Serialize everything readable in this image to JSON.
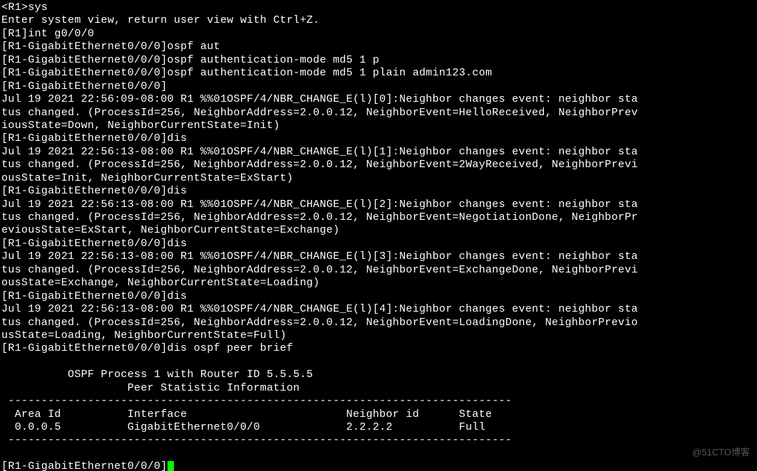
{
  "watermark": "@51CTO博客",
  "terminal": {
    "lines": [
      "<R1>sys",
      "Enter system view, return user view with Ctrl+Z.",
      "[R1]int g0/0/0",
      "[R1-GigabitEthernet0/0/0]ospf aut",
      "[R1-GigabitEthernet0/0/0]ospf authentication-mode md5 1 p",
      "[R1-GigabitEthernet0/0/0]ospf authentication-mode md5 1 plain admin123.com",
      "[R1-GigabitEthernet0/0/0]",
      "Jul 19 2021 22:56:09-08:00 R1 %%01OSPF/4/NBR_CHANGE_E(l)[0]:Neighbor changes event: neighbor sta",
      "tus changed. (ProcessId=256, NeighborAddress=2.0.0.12, NeighborEvent=HelloReceived, NeighborPrev",
      "iousState=Down, NeighborCurrentState=Init)",
      "[R1-GigabitEthernet0/0/0]dis",
      "Jul 19 2021 22:56:13-08:00 R1 %%01OSPF/4/NBR_CHANGE_E(l)[1]:Neighbor changes event: neighbor sta",
      "tus changed. (ProcessId=256, NeighborAddress=2.0.0.12, NeighborEvent=2WayReceived, NeighborPrevi",
      "ousState=Init, NeighborCurrentState=ExStart)",
      "[R1-GigabitEthernet0/0/0]dis",
      "Jul 19 2021 22:56:13-08:00 R1 %%01OSPF/4/NBR_CHANGE_E(l)[2]:Neighbor changes event: neighbor sta",
      "tus changed. (ProcessId=256, NeighborAddress=2.0.0.12, NeighborEvent=NegotiationDone, NeighborPr",
      "eviousState=ExStart, NeighborCurrentState=Exchange)",
      "[R1-GigabitEthernet0/0/0]dis",
      "Jul 19 2021 22:56:13-08:00 R1 %%01OSPF/4/NBR_CHANGE_E(l)[3]:Neighbor changes event: neighbor sta",
      "tus changed. (ProcessId=256, NeighborAddress=2.0.0.12, NeighborEvent=ExchangeDone, NeighborPrevi",
      "ousState=Exchange, NeighborCurrentState=Loading)",
      "[R1-GigabitEthernet0/0/0]dis",
      "Jul 19 2021 22:56:13-08:00 R1 %%01OSPF/4/NBR_CHANGE_E(l)[4]:Neighbor changes event: neighbor sta",
      "tus changed. (ProcessId=256, NeighborAddress=2.0.0.12, NeighborEvent=LoadingDone, NeighborPrevio",
      "usState=Loading, NeighborCurrentState=Full)",
      "[R1-GigabitEthernet0/0/0]dis ospf peer brief",
      "",
      "\t  OSPF Process 1 with Router ID 5.5.5.5",
      "\t\t   Peer Statistic Information",
      " ----------------------------------------------------------------------------",
      "  Area Id          Interface                        Neighbor id      State",
      "  0.0.0.5          GigabitEthernet0/0/0             2.2.2.2          Full",
      " ----------------------------------------------------------------------------",
      "",
      "[R1-GigabitEthernet0/0/0]"
    ]
  },
  "ospf_peer_brief": {
    "title": "OSPF Process 1 with Router ID 5.5.5.5",
    "subtitle": "Peer Statistic Information",
    "columns": [
      "Area Id",
      "Interface",
      "Neighbor id",
      "State"
    ],
    "rows": [
      {
        "area_id": "0.0.0.5",
        "interface": "GigabitEthernet0/0/0",
        "neighbor_id": "2.2.2.2",
        "state": "Full"
      }
    ]
  }
}
